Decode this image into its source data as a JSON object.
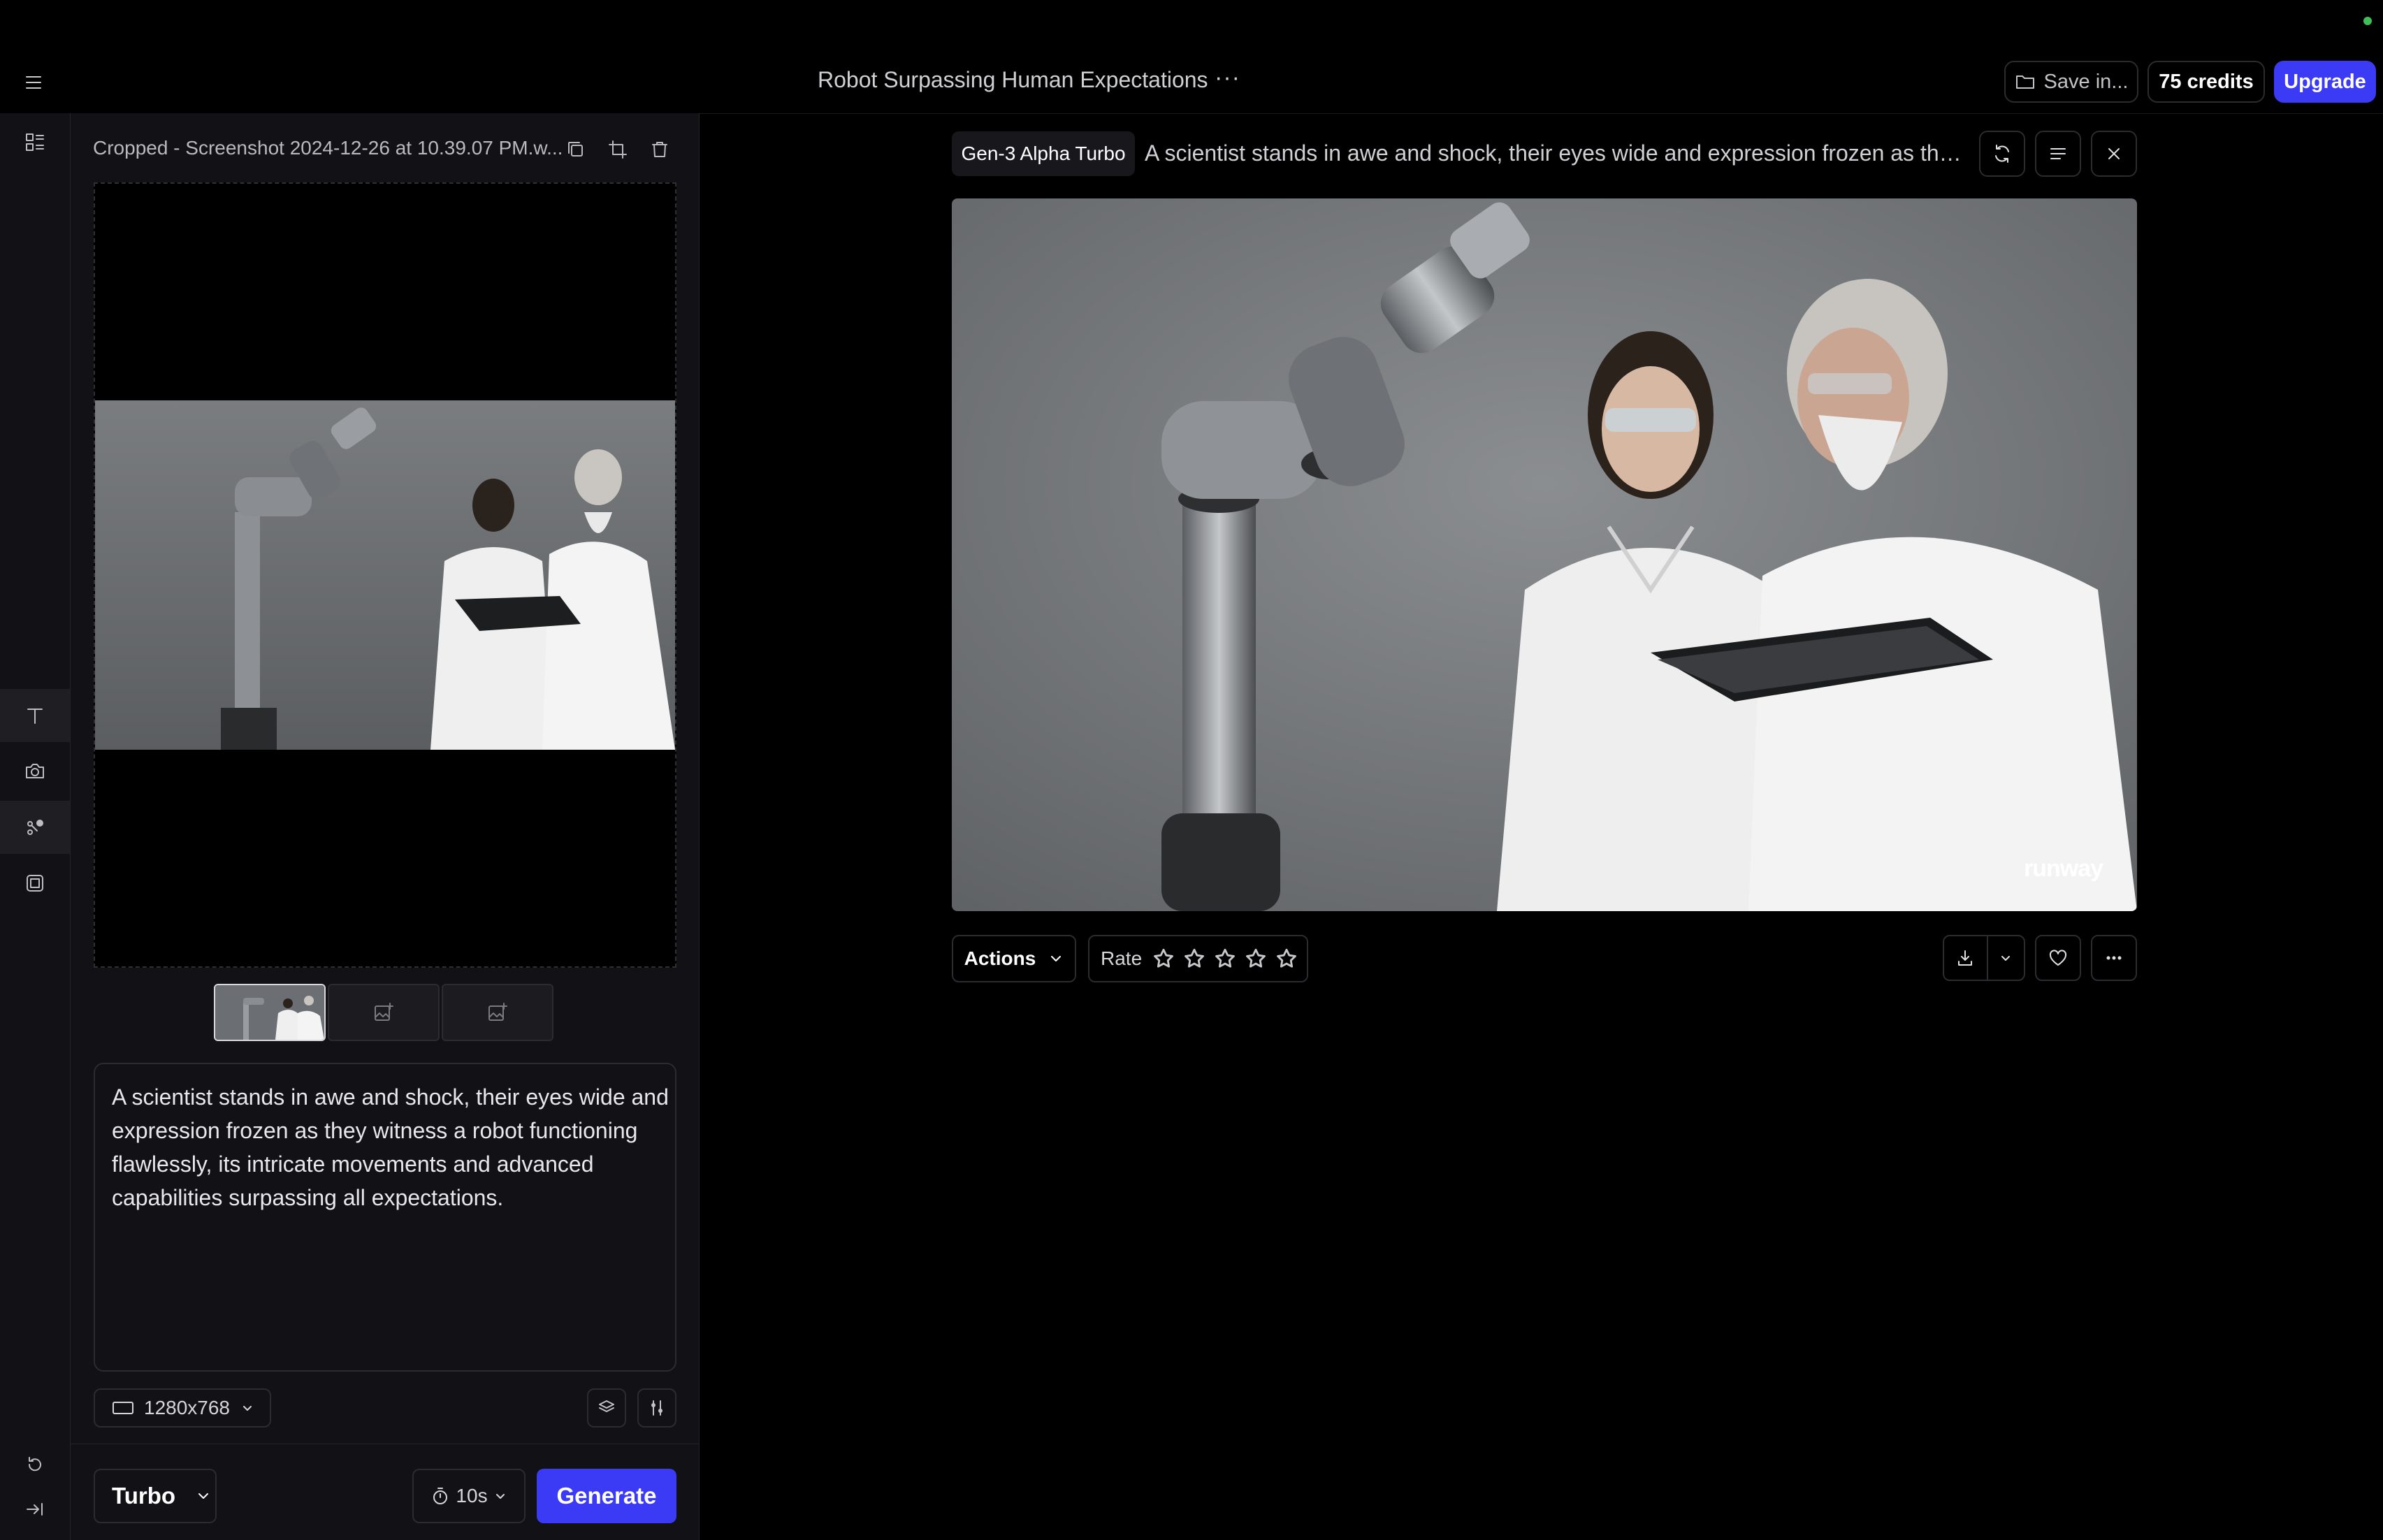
{
  "header": {
    "project_title": "Robot Surpassing Human Expectations",
    "more_label": "···",
    "save_label": "Save in...",
    "credits_label": "75 credits",
    "upgrade_label": "Upgrade"
  },
  "rail": {
    "items": [
      {
        "icon": "assets-icon"
      },
      {
        "icon": "text-icon"
      },
      {
        "icon": "camera-icon"
      },
      {
        "icon": "motion-brush-icon"
      },
      {
        "icon": "film-icon"
      },
      {
        "icon": "undo-icon"
      },
      {
        "icon": "collapse-icon"
      }
    ]
  },
  "panel": {
    "file_name": "Cropped - Screenshot 2024-12-26 at 10.39.07 PM.w...",
    "prompt_text": "A scientist stands in awe and shock, their eyes wide and expression frozen as they witness a robot functioning flawlessly, its intricate movements and advanced capabilities surpassing all expectations.",
    "resolution_label": "1280x768",
    "model_label": "Turbo",
    "duration_label": "10s",
    "generate_label": "Generate"
  },
  "result": {
    "model_chip": "Gen-3 Alpha Turbo",
    "prompt": "A scientist stands in awe and shock, their eyes wide and expression frozen as they witness a robot functioning flawlessly, its intricate movements and advanced capabilities surpassing all expectations.",
    "watermark": "runway",
    "actions_label": "Actions",
    "rate_label": "Rate",
    "rating": 0,
    "rating_max": 5
  },
  "colors": {
    "accent": "#3b3bf5",
    "background": "#000000",
    "panel": "#121216",
    "status_dot": "#3fbf55"
  }
}
